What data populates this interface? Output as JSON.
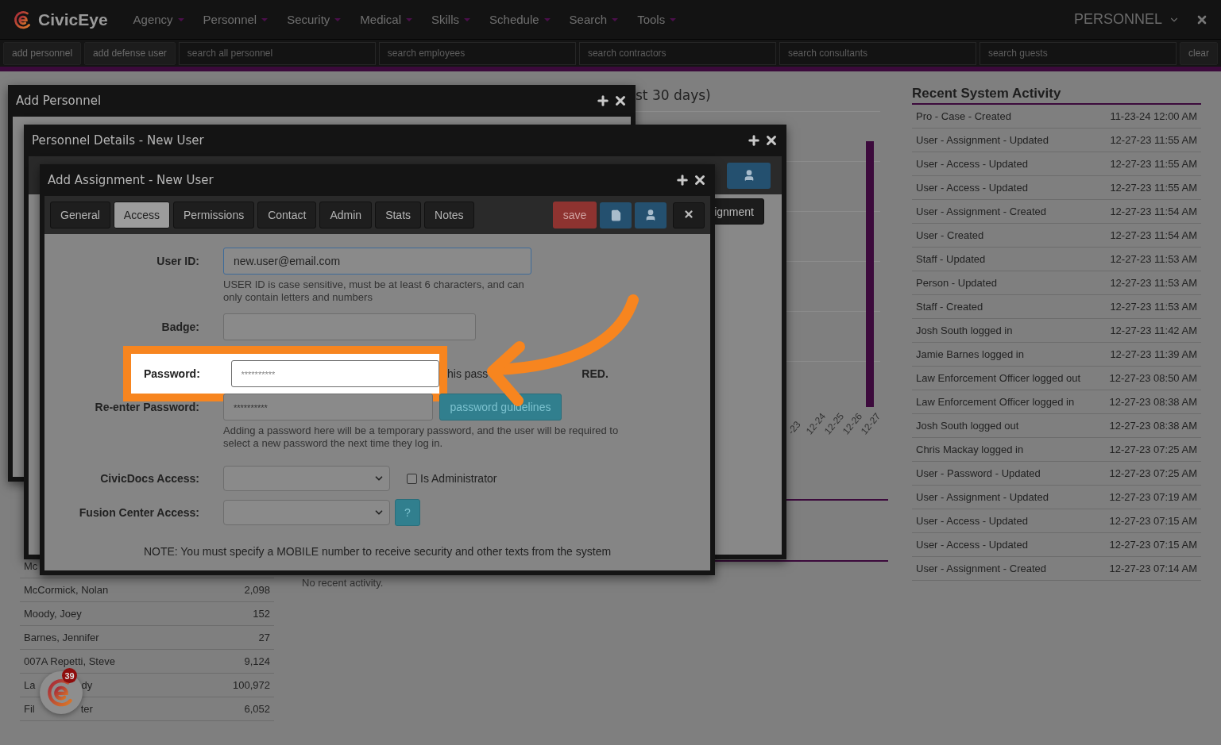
{
  "nav": {
    "brand": "CivicEye",
    "menus": [
      {
        "label": "Agency"
      },
      {
        "label": "Personnel"
      },
      {
        "label": "Security"
      },
      {
        "label": "Medical"
      },
      {
        "label": "Skills"
      },
      {
        "label": "Schedule"
      },
      {
        "label": "Search"
      },
      {
        "label": "Tools"
      }
    ],
    "module": "PERSONNEL"
  },
  "toolbar": {
    "buttons": [
      "add personnel",
      "add defense user"
    ],
    "searches": [
      "search all personnel",
      "search employees",
      "search contractors",
      "search consultants",
      "search guests"
    ],
    "clear": "clear"
  },
  "personnel_list": [
    {
      "name": "Mc"
    },
    {
      "name": "McCormick, Nolan",
      "count": "2,098"
    },
    {
      "name": "Moody, Joey",
      "count": "152"
    },
    {
      "name": "Barnes, Jennifer",
      "count": "27"
    },
    {
      "name": "007A Repetti, Steve",
      "count": "9,124"
    },
    {
      "name": "La",
      "tail": "dy",
      "count": "100,972"
    },
    {
      "name": "Fil",
      "tail": "ter",
      "count": "6,052"
    }
  ],
  "chart": {
    "title": "st 30 days)",
    "labels": [
      "-23",
      "12-24",
      "12-25",
      "12-26",
      "12-27"
    ]
  },
  "recent_note": "No recent activity.",
  "activity": {
    "title": "Recent System Activity",
    "rows": [
      {
        "event": "Pro - Case - Created",
        "time": "11-23-24 12:00 AM"
      },
      {
        "event": "User - Assignment - Updated",
        "time": "12-27-23 11:55 AM"
      },
      {
        "event": "User - Access - Updated",
        "time": "12-27-23 11:55 AM"
      },
      {
        "event": "User - Access - Updated",
        "time": "12-27-23 11:55 AM"
      },
      {
        "event": "User - Assignment - Created",
        "time": "12-27-23 11:54 AM"
      },
      {
        "event": "User - Created",
        "time": "12-27-23 11:54 AM"
      },
      {
        "event": "Staff - Updated",
        "time": "12-27-23 11:53 AM"
      },
      {
        "event": "Person - Updated",
        "time": "12-27-23 11:53 AM"
      },
      {
        "event": "Staff - Created",
        "time": "12-27-23 11:53 AM"
      },
      {
        "event": "Josh South logged in",
        "time": "12-27-23 11:42 AM"
      },
      {
        "event": "Jamie Barnes logged in",
        "time": "12-27-23 11:39 AM"
      },
      {
        "event": "Law Enforcement Officer logged out",
        "time": "12-27-23 08:50 AM"
      },
      {
        "event": "Law Enforcement Officer logged in",
        "time": "12-27-23 08:38 AM"
      },
      {
        "event": "Josh South logged out",
        "time": "12-27-23 08:38 AM"
      },
      {
        "event": "Chris Mackay logged in",
        "time": "12-27-23 07:25 AM"
      },
      {
        "event": "User - Password - Updated",
        "time": "12-27-23 07:25 AM"
      },
      {
        "event": "User - Assignment - Updated",
        "time": "12-27-23 07:19 AM"
      },
      {
        "event": "User - Access - Updated",
        "time": "12-27-23 07:15 AM"
      },
      {
        "event": "User - Access - Updated",
        "time": "12-27-23 07:15 AM"
      },
      {
        "event": "User - Assignment - Created",
        "time": "12-27-23 07:14 AM"
      }
    ]
  },
  "add_personnel_window": {
    "title": "Add Personnel"
  },
  "details_window": {
    "title": "Personnel Details - New User",
    "button": "ignment"
  },
  "assignment_window": {
    "title": "Add Assignment - New User",
    "tabs": [
      {
        "label": "General",
        "selected": false
      },
      {
        "label": "Access",
        "selected": true
      },
      {
        "label": "Permissions",
        "selected": false
      },
      {
        "label": "Contact",
        "selected": false
      },
      {
        "label": "Admin",
        "selected": false
      },
      {
        "label": "Stats",
        "selected": false
      },
      {
        "label": "Notes",
        "selected": false
      }
    ],
    "save": "save",
    "user_id": {
      "label": "User ID:",
      "value": "new.user@email.com",
      "help": "USER ID is case sensitive, must be at least 6 characters, and can only contain letters and numbers"
    },
    "badge": {
      "label": "Badge:"
    },
    "password": {
      "label": "Password:",
      "placeholder": "**********",
      "note_start": "his pass",
      "note_end": "RED."
    },
    "reenter": {
      "label": "Re-enter Password:",
      "placeholder": "**********",
      "button": "password guidelines",
      "help": "Adding a password here will be a temporary password, and the user will be required to select a new password the next time they log in."
    },
    "civicdocs": {
      "label": "CivicDocs Access:",
      "admin_label": "Is Administrator",
      "admin_checked": false
    },
    "fusion": {
      "label": "Fusion Center Access:",
      "help_button": "?"
    },
    "note": "NOTE: You must specify a MOBILE number to receive security and other texts from the system"
  },
  "floating_badge": "39"
}
